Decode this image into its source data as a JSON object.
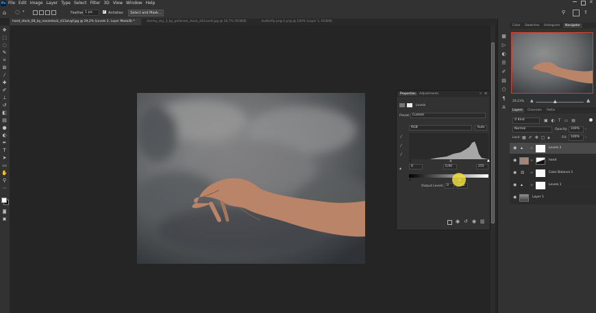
{
  "app": {
    "logo": "Ps"
  },
  "menu": [
    "File",
    "Edit",
    "Image",
    "Layer",
    "Type",
    "Select",
    "Filter",
    "3D",
    "View",
    "Window",
    "Help"
  ],
  "options_bar": {
    "feather_label": "Feather:",
    "feather_value": "1 px",
    "antialias_label": "Antialias",
    "select_mask_label": "Select and Mask..."
  },
  "tabs": [
    {
      "label": "hand_stock_68_by_noxiestock_d11wvgf.jpg @ 29,2% (Levels 2, Layer Mask/8) *",
      "active": true
    },
    {
      "label": "stormy_sky_3_by_pellaram_stock_d22uan6.jpg @ 16,7% (RGB/8)",
      "active": false
    },
    {
      "label": "butterfly-png-1.png @ 100% (Layer 1, RGB/8)",
      "active": false
    }
  ],
  "navigator": {
    "tabs": [
      "Color",
      "Swatches",
      "Histogram",
      "Navigator"
    ],
    "active_tab": "Navigator",
    "zoom": "29,23%"
  },
  "properties": {
    "tabs": [
      "Properties",
      "Adjustments"
    ],
    "active_tab": "Properties",
    "adjustment_name": "Levels",
    "preset_label": "Preset:",
    "preset_value": "Custom",
    "channel_value": "RGB",
    "auto_label": "Auto",
    "input_black": "0",
    "input_gamma": "0,90",
    "input_white": "255",
    "output_label": "Output Levels:",
    "output_black": "0",
    "output_white": "182"
  },
  "layers": {
    "tabs": [
      "Layers",
      "Channels",
      "Paths"
    ],
    "active_tab": "Layers",
    "kind_label": "Kind",
    "blend_mode": "Normal",
    "opacity_label": "Opacity:",
    "opacity_value": "100%",
    "lock_label": "Lock:",
    "fill_label": "Fill:",
    "fill_value": "100%",
    "items": [
      {
        "name": "Levels 2",
        "selected": true
      },
      {
        "name": "hand",
        "selected": false
      },
      {
        "name": "Color Balance 1",
        "selected": false
      },
      {
        "name": "Levels 1",
        "selected": false
      },
      {
        "name": "Layer 1",
        "selected": false
      }
    ]
  },
  "colors": {
    "panel": "#323232",
    "canvas": "#252525",
    "accent_highlight": "#ecdc3c",
    "navigator_frame": "#e0392e"
  }
}
